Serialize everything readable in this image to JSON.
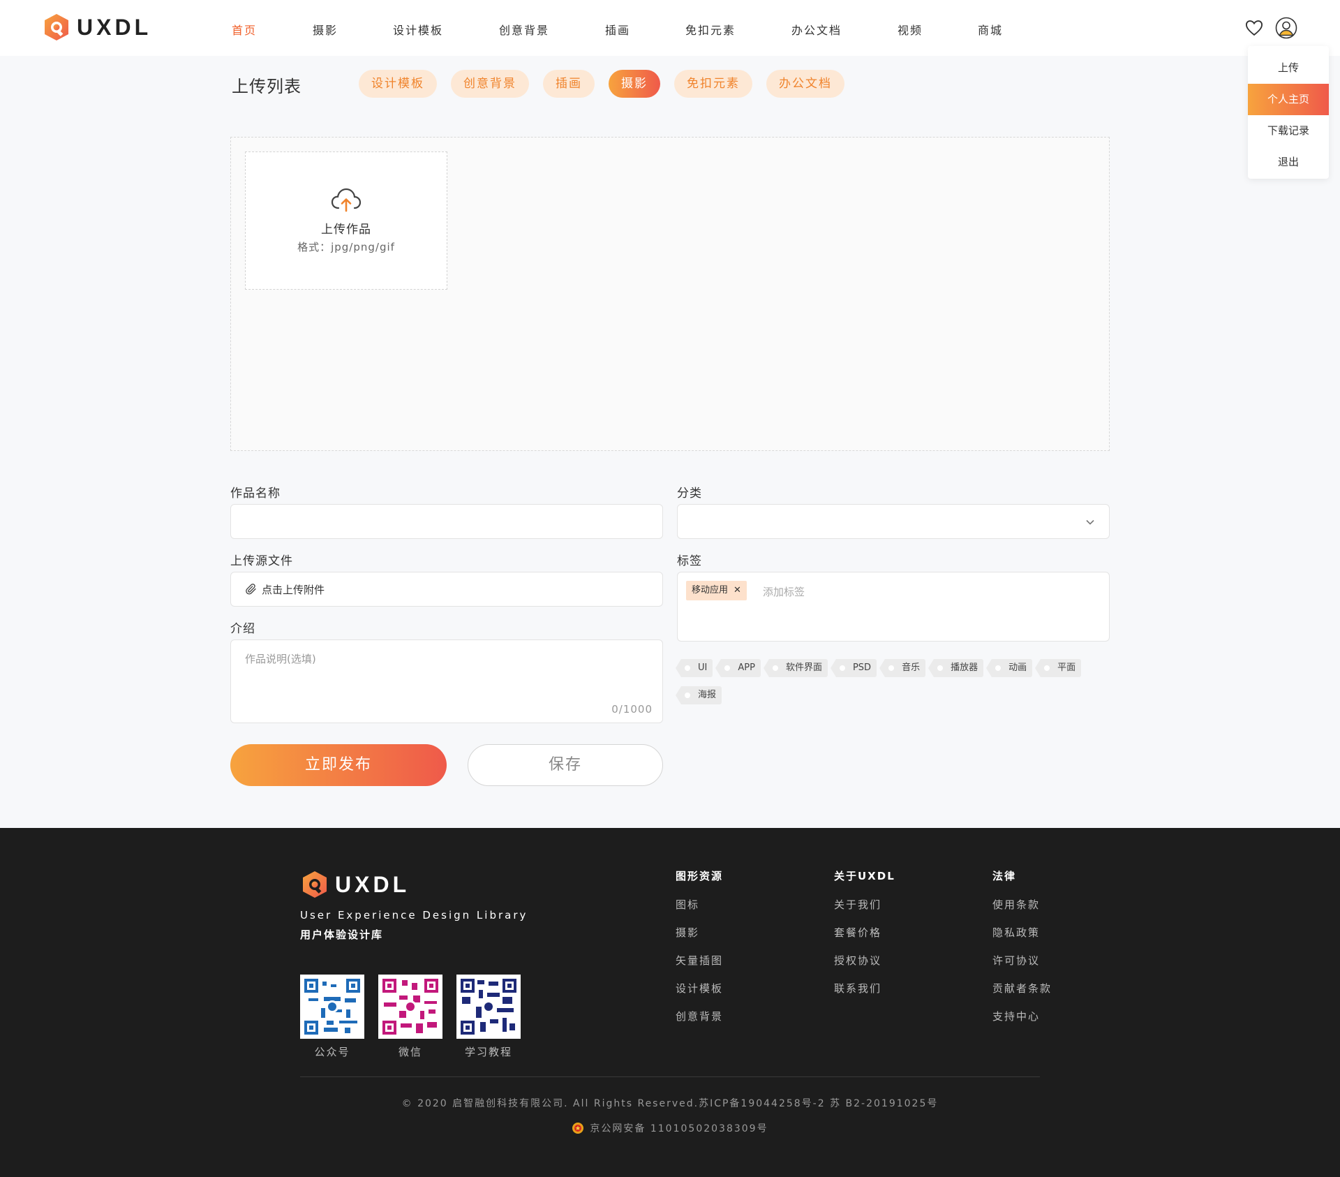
{
  "header": {
    "logo_text": "UXDL",
    "nav": [
      {
        "label": "首页",
        "active": true
      },
      {
        "label": "摄影"
      },
      {
        "label": "设计模板"
      },
      {
        "label": "创意背景"
      },
      {
        "label": "插画"
      },
      {
        "label": "免扣元素"
      },
      {
        "label": "办公文档"
      },
      {
        "label": "视频"
      },
      {
        "label": "商城"
      }
    ],
    "user_menu": [
      "上传",
      "个人主页",
      "下载记录",
      "退出"
    ],
    "user_menu_active": "个人主页"
  },
  "main": {
    "title": "上传列表",
    "categories": [
      {
        "label": "设计模板"
      },
      {
        "label": "创意背景"
      },
      {
        "label": "插画"
      },
      {
        "label": "摄影",
        "active": true
      },
      {
        "label": "免扣元素"
      },
      {
        "label": "办公文档"
      }
    ],
    "upload": {
      "label": "上传作品",
      "format": "格式：jpg/png/gif"
    },
    "form": {
      "name_label": "作品名称",
      "name_value": "",
      "category_label": "分类",
      "category_value": "",
      "source_label": "上传源文件",
      "source_button": "点击上传附件",
      "tags_label": "标签",
      "tag_chip": "移动应用",
      "tag_placeholder": "添加标签",
      "suggested_tags": [
        "UI",
        "APP",
        "软件界面",
        "PSD",
        "音乐",
        "播放器",
        "动画",
        "平面",
        "海报"
      ],
      "intro_label": "介绍",
      "intro_placeholder": "作品说明(选填)",
      "intro_counter": "0/1000"
    },
    "publish_button": "立即发布",
    "save_button": "保存"
  },
  "footer": {
    "logo_text": "UXDL",
    "tagline": "User Experience Design Library",
    "tagline_cn": "用户体验设计库",
    "qrs": [
      {
        "label": "公众号",
        "color": "#1e6bb8"
      },
      {
        "label": "微信",
        "color": "#c2187b"
      },
      {
        "label": "学习教程",
        "color": "#1e2a78"
      }
    ],
    "columns": [
      {
        "title": "图形资源",
        "links": [
          "图标",
          "摄影",
          "矢量插图",
          "设计模板",
          "创意背景"
        ]
      },
      {
        "title": "关于UXDL",
        "links": [
          "关于我们",
          "套餐价格",
          "授权协议",
          "联系我们"
        ]
      },
      {
        "title": "法律",
        "links": [
          "使用条款",
          "隐私政策",
          "许可协议",
          "贡献者条款",
          "支持中心"
        ]
      }
    ],
    "copyright": "© 2020 启智融创科技有限公司. All Rights Reserved.苏ICP备19044258号-2 苏 B2-20191025号",
    "beian": "京公网安备 11010502038309号"
  },
  "colors": {
    "accent": "#f0602b",
    "gradient_start": "#f7a33e",
    "gradient_end": "#ef5a4a",
    "footer_bg": "#1d1d1d"
  }
}
